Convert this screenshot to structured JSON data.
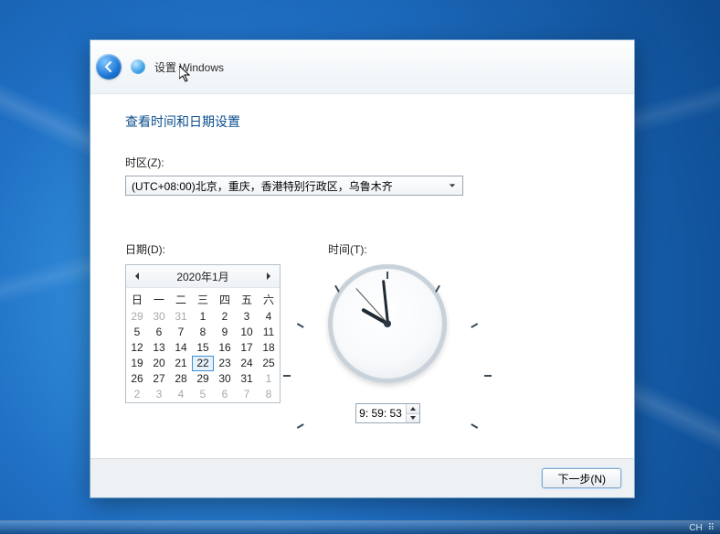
{
  "header": {
    "title": "设置 Windows"
  },
  "page": {
    "title": "查看时间和日期设置"
  },
  "timezone": {
    "label": "时区(Z):",
    "selected": "(UTC+08:00)北京，重庆，香港特别行政区，乌鲁木齐"
  },
  "date": {
    "label": "日期(D):",
    "month_title": "2020年1月",
    "daynames": [
      "日",
      "一",
      "二",
      "三",
      "四",
      "五",
      "六"
    ],
    "cells": [
      {
        "n": "29",
        "other": true
      },
      {
        "n": "30",
        "other": true
      },
      {
        "n": "31",
        "other": true
      },
      {
        "n": "1"
      },
      {
        "n": "2"
      },
      {
        "n": "3"
      },
      {
        "n": "4"
      },
      {
        "n": "5"
      },
      {
        "n": "6"
      },
      {
        "n": "7"
      },
      {
        "n": "8"
      },
      {
        "n": "9"
      },
      {
        "n": "10"
      },
      {
        "n": "11"
      },
      {
        "n": "12"
      },
      {
        "n": "13"
      },
      {
        "n": "14"
      },
      {
        "n": "15"
      },
      {
        "n": "16"
      },
      {
        "n": "17"
      },
      {
        "n": "18"
      },
      {
        "n": "19"
      },
      {
        "n": "20"
      },
      {
        "n": "21"
      },
      {
        "n": "22",
        "selected": true
      },
      {
        "n": "23"
      },
      {
        "n": "24"
      },
      {
        "n": "25"
      },
      {
        "n": "26"
      },
      {
        "n": "27"
      },
      {
        "n": "28"
      },
      {
        "n": "29"
      },
      {
        "n": "30"
      },
      {
        "n": "31"
      },
      {
        "n": "1",
        "other": true
      },
      {
        "n": "2",
        "other": true
      },
      {
        "n": "3",
        "other": true
      },
      {
        "n": "4",
        "other": true
      },
      {
        "n": "5",
        "other": true
      },
      {
        "n": "6",
        "other": true
      },
      {
        "n": "7",
        "other": true
      },
      {
        "n": "8",
        "other": true
      }
    ]
  },
  "time": {
    "label": "时间(T):",
    "value": "9: 59: 53",
    "hour": 9,
    "minute": 59,
    "second": 53
  },
  "footer": {
    "next": "下一步(N)"
  },
  "tray": {
    "lang": "CH"
  }
}
